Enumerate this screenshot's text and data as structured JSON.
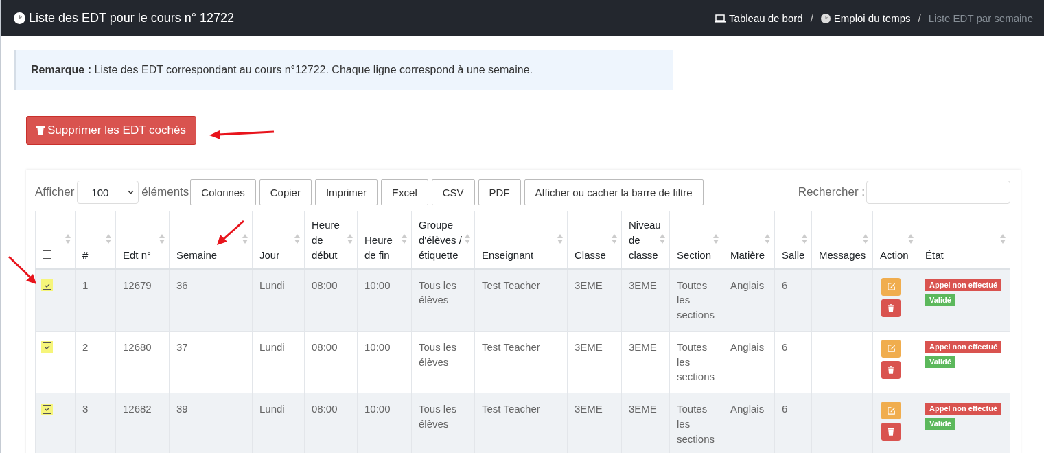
{
  "header": {
    "title": "Liste des EDT pour le cours n° 12722",
    "breadcrumb_separator": "/",
    "breadcrumb": [
      {
        "label": "Tableau de bord",
        "current": false
      },
      {
        "label": "Emploi du temps",
        "current": false
      },
      {
        "label": "Liste EDT par semaine",
        "current": true
      }
    ]
  },
  "remark": {
    "label": "Remarque :",
    "text": "Liste des EDT correspondant au cours n°12722. Chaque ligne correspond à une semaine."
  },
  "delete_checked_button": "Supprimer les EDT cochés",
  "toolbar": {
    "show_label": "Afficher",
    "page_size": "100",
    "entries_label": "éléments",
    "buttons": [
      "Colonnes",
      "Copier",
      "Imprimer",
      "Excel",
      "CSV",
      "PDF",
      "Afficher ou cacher la barre de filtre"
    ],
    "search_label": "Rechercher :"
  },
  "table": {
    "select_all": {
      "checked": false
    },
    "columns": [
      "#",
      "Edt n°",
      "Semaine",
      "Jour",
      "Heure de début",
      "Heure de fin",
      "Groupe d'élèves / étiquette",
      "Enseignant",
      "Classe",
      "Niveau de classe",
      "Section",
      "Matière",
      "Salle",
      "Messages",
      "Action",
      "État"
    ],
    "rows": [
      {
        "checked": true,
        "cells": [
          "1",
          "12679",
          "36",
          "Lundi",
          "08:00",
          "10:00",
          "Tous les élèves",
          "Test Teacher",
          "3EME",
          "3EME",
          "Toutes les sections",
          "Anglais",
          "6",
          ""
        ],
        "statuses": [
          {
            "label": "Appel non effectué",
            "color": "#d9534f"
          },
          {
            "label": "Validé",
            "color": "#5cb85c"
          }
        ]
      },
      {
        "checked": true,
        "cells": [
          "2",
          "12680",
          "37",
          "Lundi",
          "08:00",
          "10:00",
          "Tous les élèves",
          "Test Teacher",
          "3EME",
          "3EME",
          "Toutes les sections",
          "Anglais",
          "6",
          ""
        ],
        "statuses": [
          {
            "label": "Appel non effectué",
            "color": "#d9534f"
          },
          {
            "label": "Validé",
            "color": "#5cb85c"
          }
        ]
      },
      {
        "checked": true,
        "cells": [
          "3",
          "12682",
          "39",
          "Lundi",
          "08:00",
          "10:00",
          "Tous les élèves",
          "Test Teacher",
          "3EME",
          "3EME",
          "Toutes les sections",
          "Anglais",
          "6",
          ""
        ],
        "statuses": [
          {
            "label": "Appel non effectué",
            "color": "#d9534f"
          },
          {
            "label": "Validé",
            "color": "#5cb85c"
          }
        ]
      }
    ]
  }
}
